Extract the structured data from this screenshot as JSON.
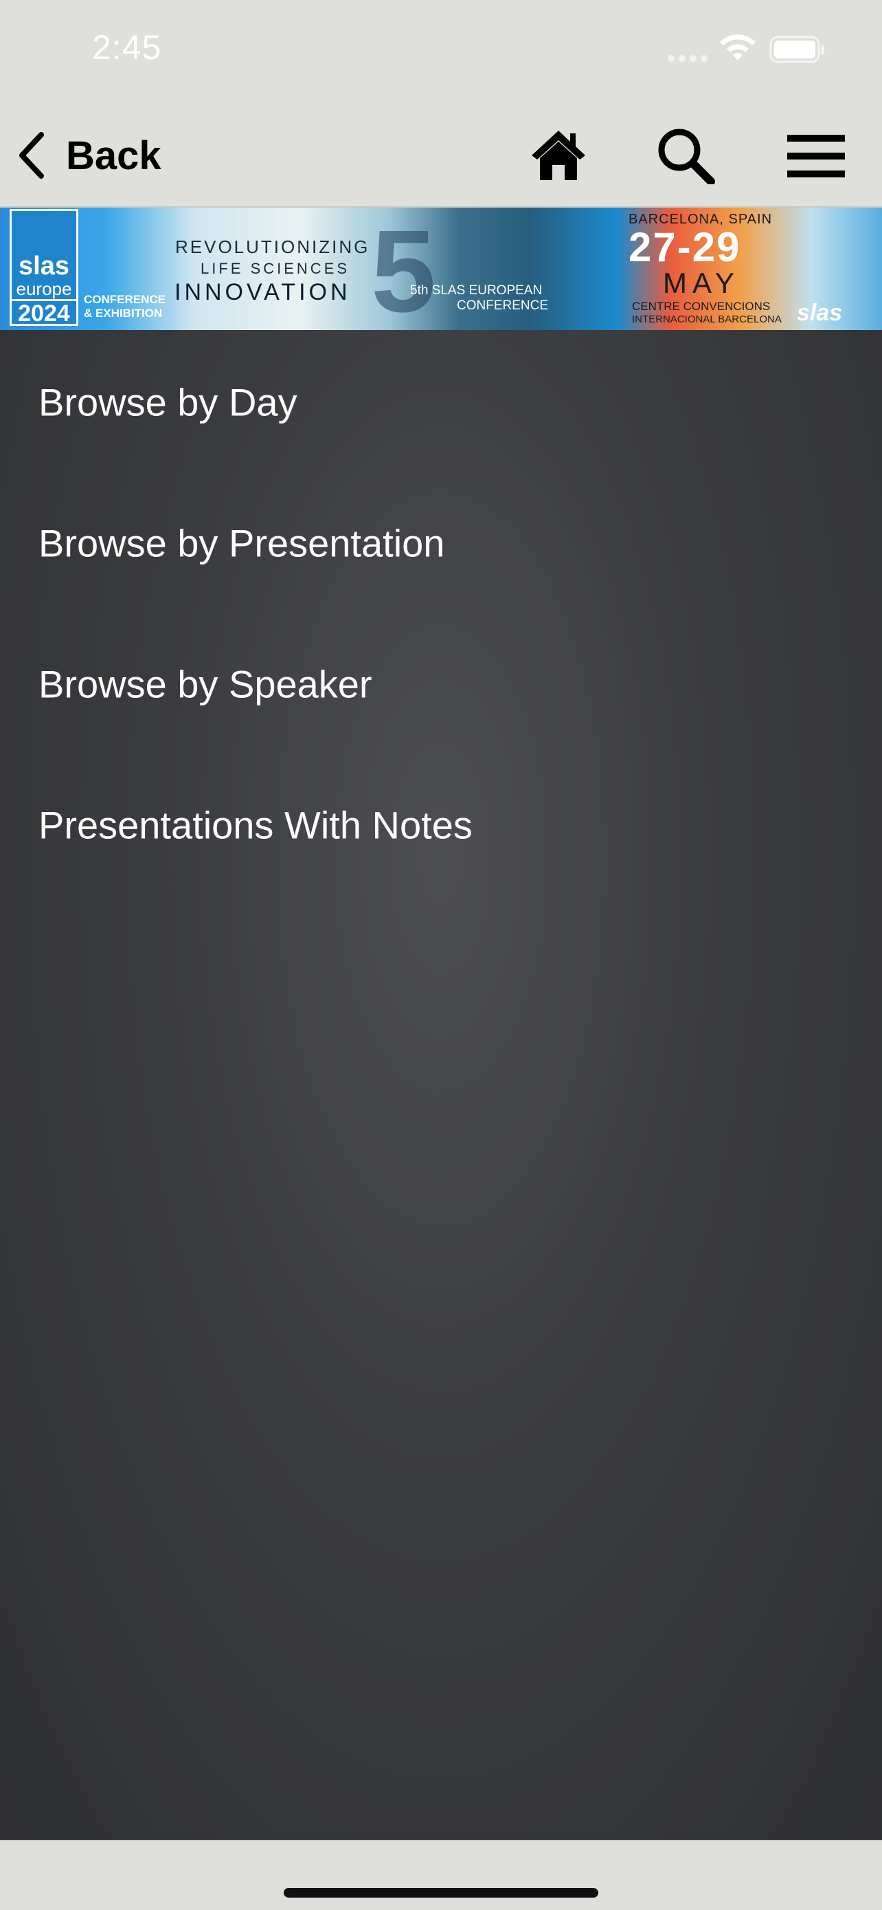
{
  "status_bar": {
    "time": "2:45",
    "icons": [
      "signal-icon",
      "wifi-icon",
      "battery-icon"
    ]
  },
  "nav_bar": {
    "back_label": "Back",
    "icons": [
      "chevron-left-icon",
      "home-icon",
      "search-icon",
      "hamburger-menu-icon"
    ]
  },
  "banner": {
    "logo_top": "slas",
    "logo_mid": "europe",
    "logo_year": "2024",
    "logo_sub_1": "CONFERENCE",
    "logo_sub_2": "& EXHIBITION",
    "headline_1": "REVOLUTIONIZING",
    "headline_2": "LIFE SCIENCES",
    "headline_3": "INNOVATION",
    "big_number": "5",
    "conference_1": "5th SLAS EUROPEAN",
    "conference_2": "CONFERENCE",
    "city": "BARCELONA, SPAIN",
    "dates": "27-29",
    "month": "MAY",
    "venue_1": "CENTRE CONVENCIONS",
    "venue_2": "INTERNACIONAL BARCELONA",
    "brand": "slas"
  },
  "menu": {
    "items": [
      {
        "label": "Browse by Day"
      },
      {
        "label": "Browse by Presentation"
      },
      {
        "label": "Browse by Speaker"
      },
      {
        "label": "Presentations With Notes"
      }
    ]
  },
  "colors": {
    "chrome_background": "#dfe0dc",
    "content_background": "#3b3c3f",
    "menu_text": "#ffffff",
    "nav_text": "#000000"
  }
}
